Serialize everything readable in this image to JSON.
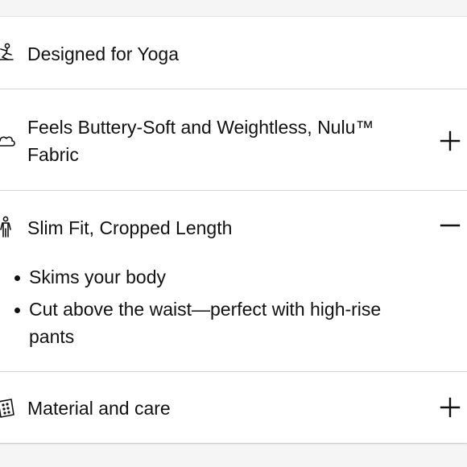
{
  "accordion": {
    "items": [
      {
        "title": "Designed for Yoga",
        "icon": "yoga-pose-icon",
        "expanded": null
      },
      {
        "title": "Feels Buttery-Soft and Weightless, Nulu™ Fabric",
        "icon": "cloud-icon",
        "expanded": false
      },
      {
        "title": "Slim Fit, Cropped Length",
        "icon": "body-fit-icon",
        "expanded": true,
        "details": [
          "Skims your body",
          "Cut above the waist—perfect with high-rise pants"
        ]
      },
      {
        "title": "Material and care",
        "icon": "fabric-swatch-icon",
        "expanded": false
      }
    ]
  }
}
